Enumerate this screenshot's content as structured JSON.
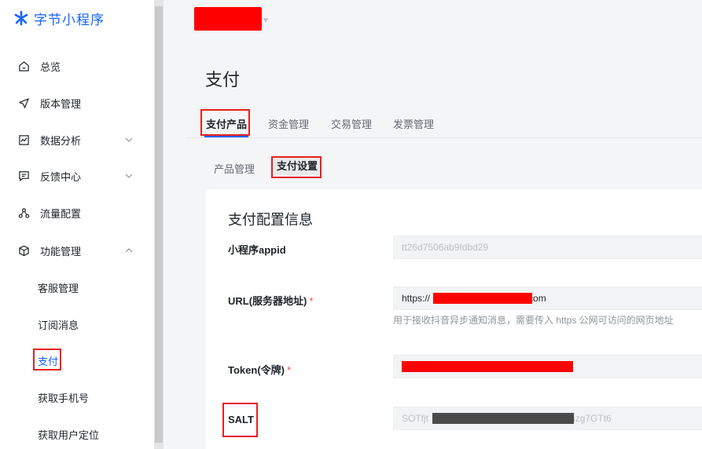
{
  "brand": {
    "name": "字节小程序",
    "color": "#1664ff"
  },
  "sidebar": {
    "items": [
      {
        "label": "总览",
        "icon": "home-icon"
      },
      {
        "label": "版本管理",
        "icon": "send-icon"
      },
      {
        "label": "数据分析",
        "icon": "chart-icon"
      },
      {
        "label": "反馈中心",
        "icon": "message-icon"
      },
      {
        "label": "流量配置",
        "icon": "share-icon"
      },
      {
        "label": "功能管理",
        "icon": "cube-icon"
      }
    ],
    "sub_items": [
      {
        "label": "客服管理"
      },
      {
        "label": "订阅消息"
      },
      {
        "label": "支付",
        "active": true
      },
      {
        "label": "获取手机号"
      },
      {
        "label": "获取用户定位"
      }
    ]
  },
  "page": {
    "title": "支付"
  },
  "tabs": [
    {
      "label": "支付产品",
      "active": true
    },
    {
      "label": "资金管理"
    },
    {
      "label": "交易管理"
    },
    {
      "label": "发票管理"
    }
  ],
  "subtabs": [
    {
      "label": "产品管理"
    },
    {
      "label": "支付设置",
      "active": true
    }
  ],
  "card": {
    "title": "支付配置信息",
    "fields": {
      "appid": {
        "label": "小程序appid",
        "value": "tt26d7506ab9fdbd29"
      },
      "url": {
        "label": "URL(服务器地址)",
        "required": "*",
        "value_prefix": "https://",
        "value_suffix": "com",
        "help": "用于接收抖音异步通知消息，需要传入 https 公网可访问的网页地址"
      },
      "token": {
        "label": "Token(令牌)",
        "required": "*"
      },
      "salt": {
        "label": "SALT",
        "value_prefix": "SOTfjt",
        "value_suffix": "nzg7GTt6"
      }
    }
  },
  "colors": {
    "highlight": "#e8201f",
    "redaction": "#ff0000",
    "accent": "#1664ff"
  }
}
